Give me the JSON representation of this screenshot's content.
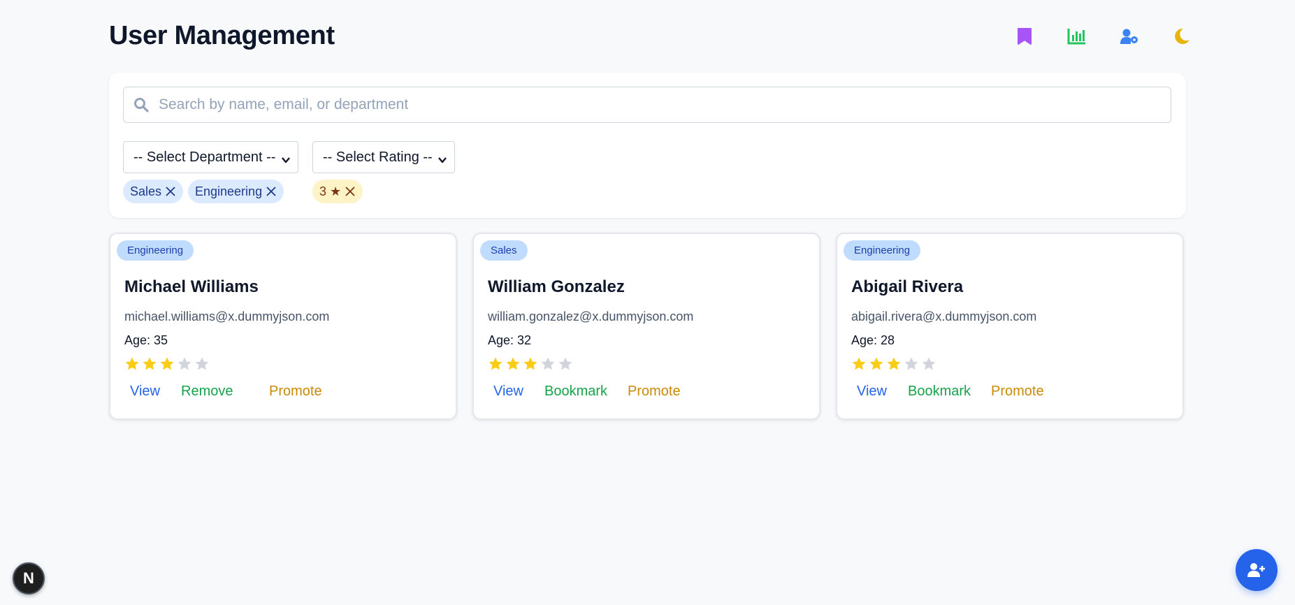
{
  "header": {
    "title": "User Management",
    "icons": [
      "bookmark-icon",
      "chart-icon",
      "user-settings-icon",
      "moon-icon"
    ],
    "icon_colors": {
      "bookmark": "#a855f7",
      "chart": "#22c55e",
      "user_settings": "#3b82f6",
      "moon": "#eab308"
    }
  },
  "filters": {
    "search_placeholder": "Search by name, email, or department",
    "search_value": "",
    "department_select": "-- Select Department --",
    "rating_select": "-- Select Rating --",
    "department_chips": [
      "Sales",
      "Engineering"
    ],
    "rating_chips": [
      "3 ★"
    ]
  },
  "users": [
    {
      "department": "Engineering",
      "name": "Michael Williams",
      "email": "michael.williams@x.dummyjson.com",
      "age": "Age: 35",
      "rating": 3,
      "rating_max": 5,
      "actions": [
        "View",
        "Remove",
        "Promote"
      ]
    },
    {
      "department": "Sales",
      "name": "William Gonzalez",
      "email": "william.gonzalez@x.dummyjson.com",
      "age": "Age: 32",
      "rating": 3,
      "rating_max": 5,
      "actions": [
        "View",
        "Bookmark",
        "Promote"
      ]
    },
    {
      "department": "Engineering",
      "name": "Abigail Rivera",
      "email": "abigail.rivera@x.dummyjson.com",
      "age": "Age: 28",
      "rating": 3,
      "rating_max": 5,
      "actions": [
        "View",
        "Bookmark",
        "Promote"
      ]
    }
  ],
  "colors": {
    "star_filled": "#facc15",
    "star_empty": "#d1d5db",
    "view": "#2563eb",
    "secondary_action": "#16a34a",
    "promote": "#ca8a04",
    "fab": "#2563eb"
  },
  "fab": {
    "icon": "add-user-icon"
  },
  "dev_badge": {
    "label": "N"
  }
}
